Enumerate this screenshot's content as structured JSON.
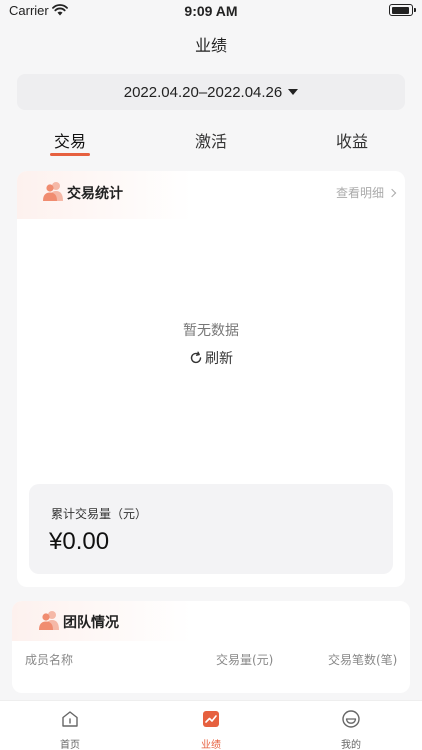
{
  "status_bar": {
    "carrier": "Carrier",
    "time": "9:09 AM"
  },
  "nav": {
    "title": "业绩"
  },
  "date_filter": {
    "range": "2022.04.20–2022.04.26"
  },
  "tabs": [
    {
      "label": "交易",
      "active": true
    },
    {
      "label": "激活",
      "active": false
    },
    {
      "label": "收益",
      "active": false
    }
  ],
  "trade_card": {
    "title": "交易统计",
    "detail_link": "查看明细",
    "empty_text": "暂无数据",
    "refresh_label": "刷新",
    "summary_label": "累计交易量（元）",
    "summary_value": "¥0.00"
  },
  "team_card": {
    "title": "团队情况",
    "columns": [
      "成员名称",
      "交易量(元)",
      "交易笔数(笔)"
    ]
  },
  "tabbar": {
    "items": [
      {
        "label": "首页",
        "icon": "home-icon",
        "active": false
      },
      {
        "label": "业绩",
        "icon": "chart-icon",
        "active": true
      },
      {
        "label": "我的",
        "icon": "smile-icon",
        "active": false
      }
    ]
  },
  "colors": {
    "accent": "#e6603f",
    "background": "#f6f6f7",
    "card": "#ffffff"
  }
}
